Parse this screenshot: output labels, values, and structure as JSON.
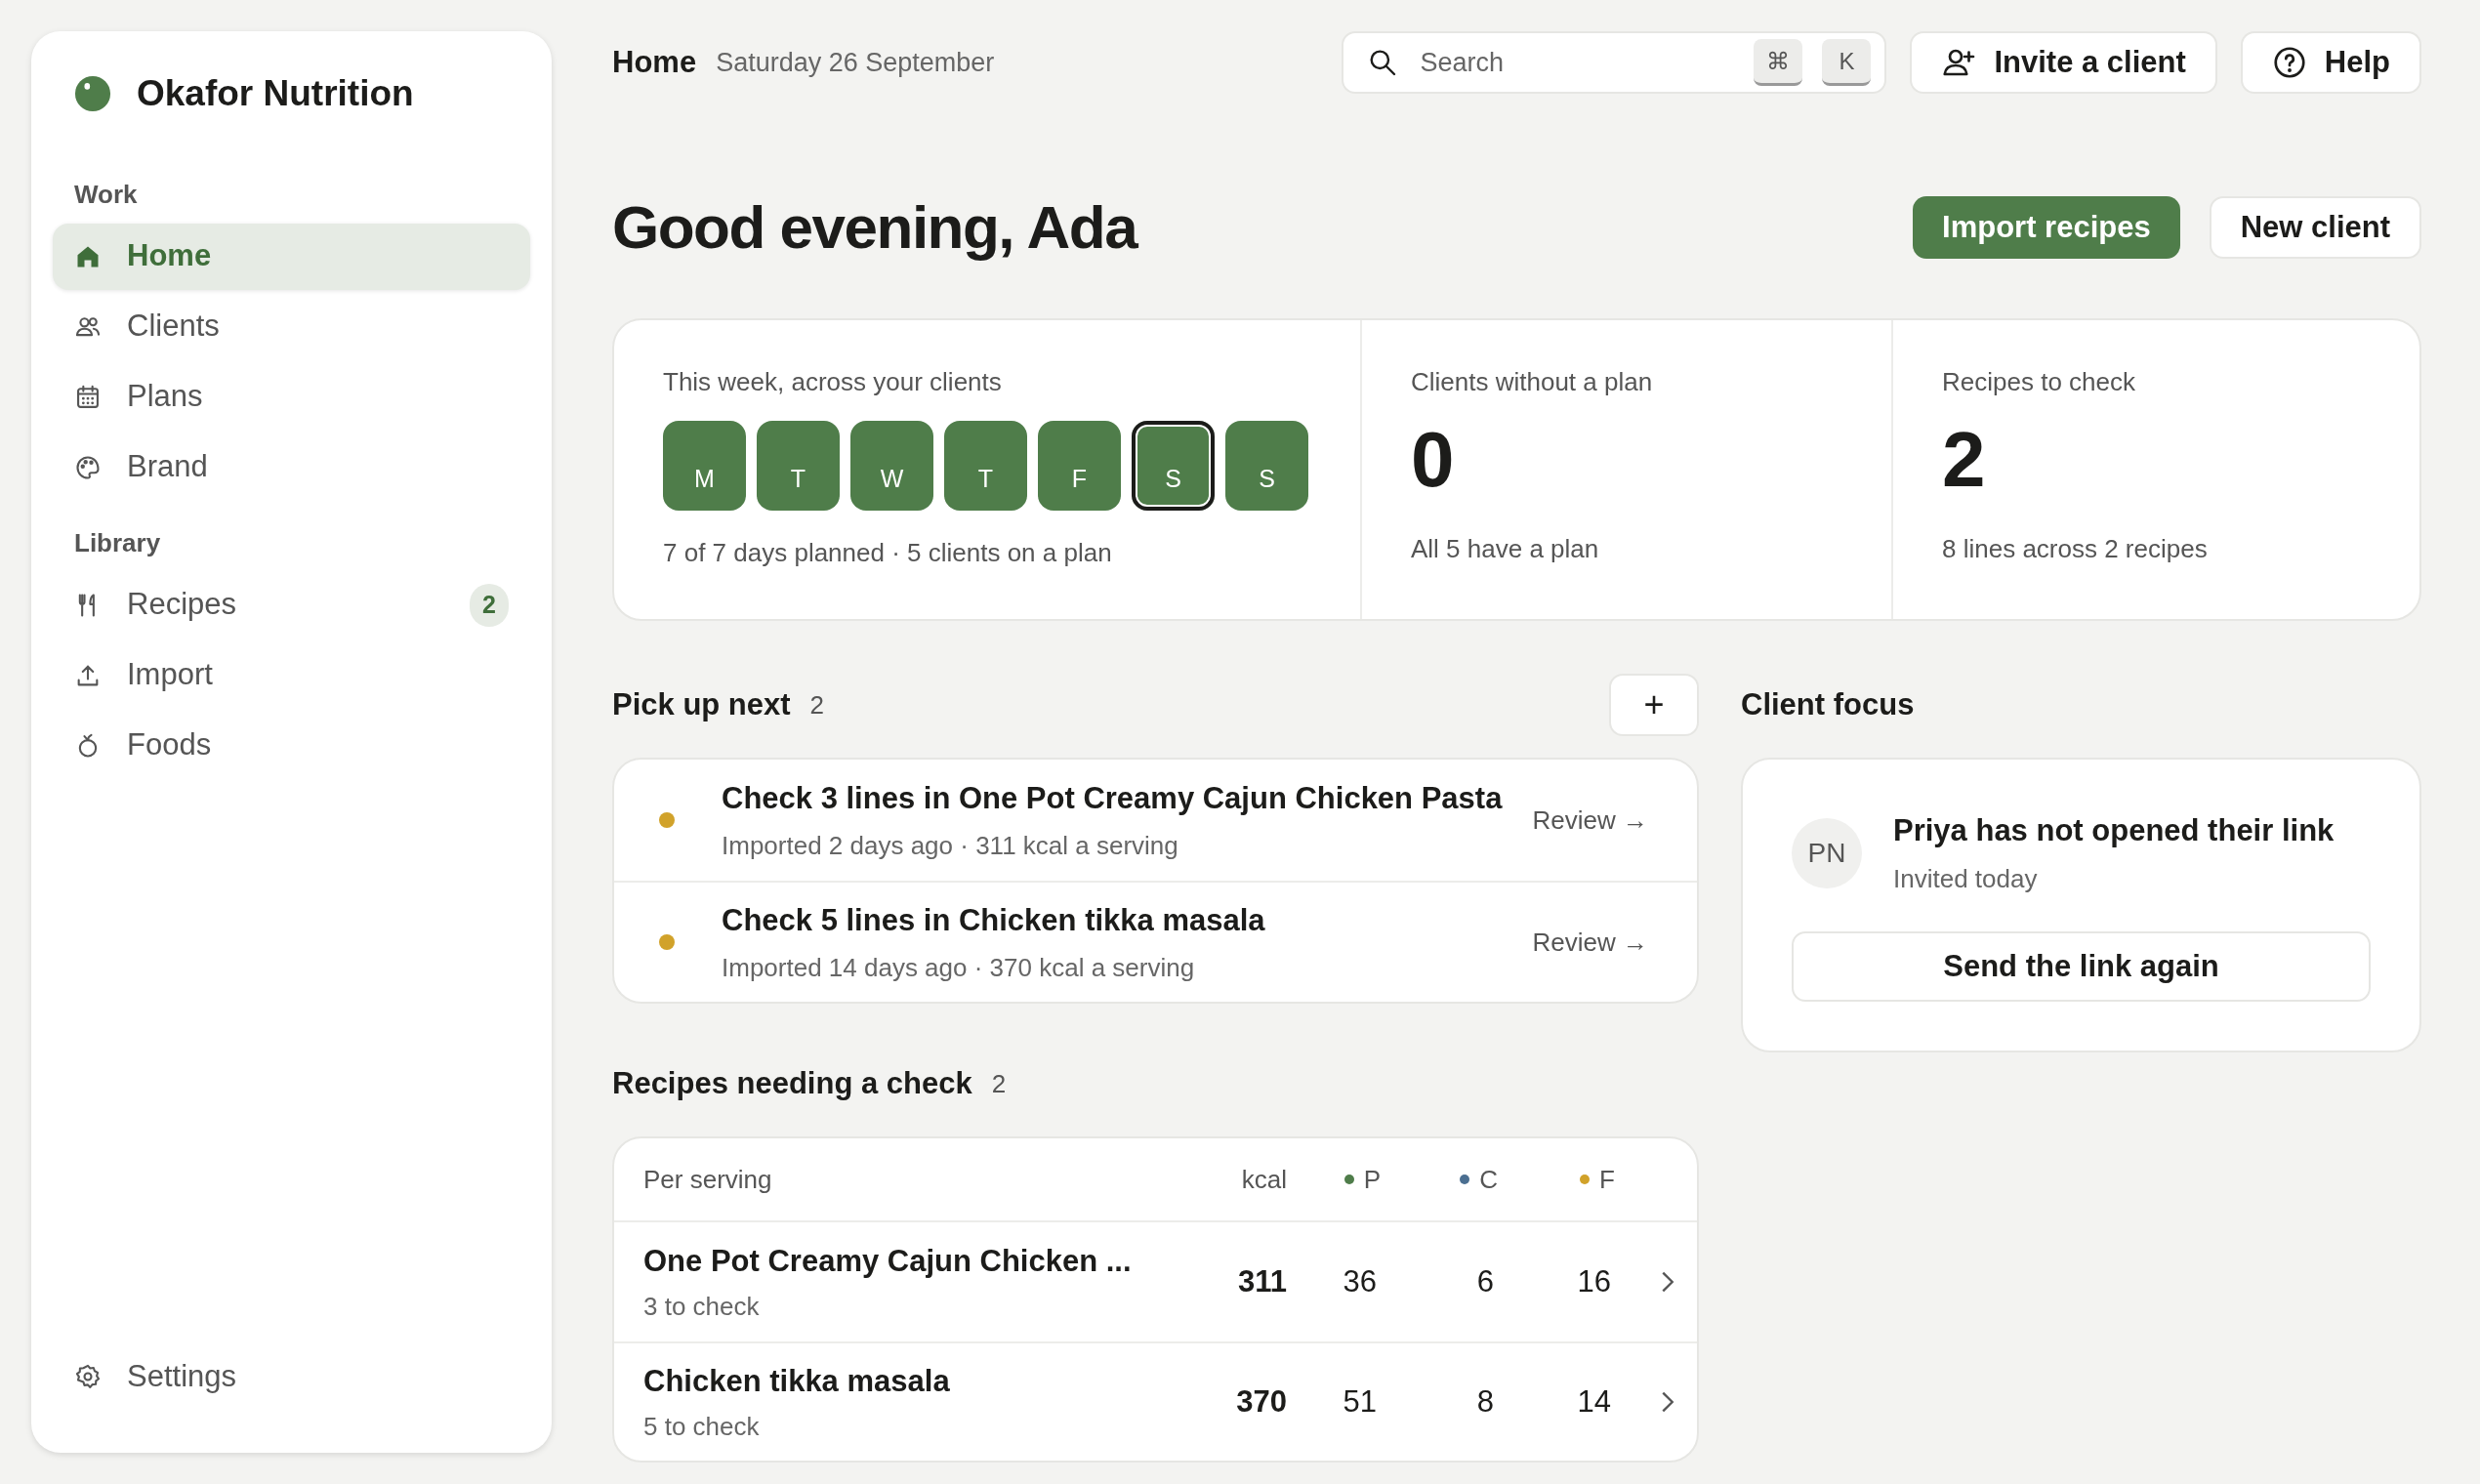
{
  "sidebar": {
    "brand": "Okafor Nutrition",
    "sections": [
      {
        "title": "Work",
        "items": [
          {
            "label": "Home",
            "selected": true
          },
          {
            "label": "Clients",
            "selected": false
          },
          {
            "label": "Plans",
            "selected": false
          },
          {
            "label": "Brand",
            "selected": false
          }
        ]
      },
      {
        "title": "Library",
        "items": [
          {
            "label": "Recipes",
            "selected": false,
            "badge": "2"
          },
          {
            "label": "Import",
            "selected": false
          },
          {
            "label": "Foods",
            "selected": false
          }
        ]
      }
    ],
    "footer": {
      "label": "Settings",
      "selected": false
    }
  },
  "header": {
    "page": "Home",
    "date": "Saturday 26 September",
    "search": {
      "placeholder": "Search",
      "keys": [
        "⌘",
        "K"
      ]
    },
    "buttons": [
      {
        "label": "Invite a client"
      },
      {
        "label": "Help"
      }
    ]
  },
  "greeting": "Good evening, Ada",
  "actions": [
    {
      "label": "Import recipes",
      "kind": "primary"
    },
    {
      "label": "New client",
      "kind": "secondary"
    }
  ],
  "stats": {
    "week": {
      "title": "This week, across your clients",
      "days": [
        {
          "label": "M",
          "planned": true,
          "selected": false
        },
        {
          "label": "T",
          "planned": true,
          "selected": false
        },
        {
          "label": "W",
          "planned": true,
          "selected": false
        },
        {
          "label": "T",
          "planned": true,
          "selected": false
        },
        {
          "label": "F",
          "planned": true,
          "selected": false
        },
        {
          "label": "S",
          "planned": true,
          "selected": true
        },
        {
          "label": "S",
          "planned": true,
          "selected": false
        }
      ],
      "summary": "7 of 7 days planned · 5 clients on a plan"
    },
    "cards": [
      {
        "title": "Clients without a plan",
        "value": "0",
        "note": "All 5 have a plan"
      },
      {
        "title": "Recipes to check",
        "value": "2",
        "note": "8 lines across 2 recipes"
      }
    ]
  },
  "pick_up_next": {
    "title": "Pick up next",
    "count": "2",
    "add": "+",
    "items": [
      {
        "title": "Check 3 lines in One Pot Creamy Cajun Chicken Pasta",
        "meta": "Imported 2 days ago · 311 kcal a serving",
        "action": "Review →",
        "color": "#d1a22a"
      },
      {
        "title": "Check 5 lines in Chicken tikka masala",
        "meta": "Imported 14 days ago · 370 kcal a serving",
        "action": "Review →",
        "color": "#d1a22a"
      }
    ]
  },
  "client_focus": {
    "title": "Client focus",
    "initials": "PN",
    "headline": "Priya has not opened their link",
    "note": "Invited today",
    "button": "Send the link again"
  },
  "recipes_check": {
    "title": "Recipes needing a check",
    "count": "2",
    "columns": [
      {
        "label": "Per serving"
      },
      {
        "label": "kcal"
      },
      {
        "label": "P",
        "color": "#4f7d4a"
      },
      {
        "label": "C",
        "color": "#4b6f91"
      },
      {
        "label": "F",
        "color": "#d1a22a"
      }
    ],
    "rows": [
      {
        "name": "One Pot Creamy Cajun Chicken ...",
        "note": "3 to check",
        "kcal": "311",
        "p": "36",
        "c": "6",
        "f": "16"
      },
      {
        "name": "Chicken tikka masala",
        "note": "5 to check",
        "kcal": "370",
        "p": "51",
        "c": "8",
        "f": "14"
      }
    ]
  }
}
